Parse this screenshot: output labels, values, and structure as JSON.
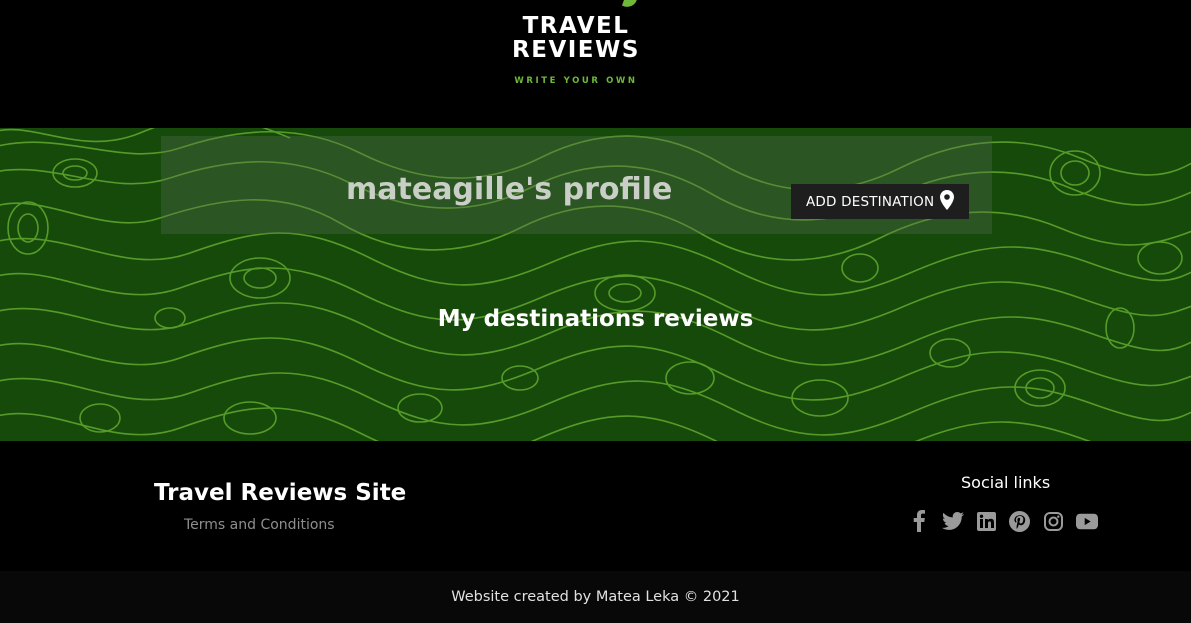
{
  "header": {
    "logo_line1": "TRAVEL",
    "logo_line2": "REVIEWS",
    "logo_tagline": "WRITE YOUR OWN"
  },
  "profile": {
    "title": "mateagille's profile",
    "add_button_label": "ADD DESTINATION",
    "add_button_icon": "map-pin-icon"
  },
  "main": {
    "section_title": "My destinations reviews"
  },
  "footer": {
    "site_name": "Travel Reviews Site",
    "terms_link": "Terms and Conditions",
    "social_title": "Social links",
    "social_icons": [
      "facebook-icon",
      "twitter-icon",
      "linkedin-icon",
      "pinterest-icon",
      "instagram-icon",
      "youtube-icon"
    ],
    "copyright": "Website created by Matea Leka © 2021"
  },
  "colors": {
    "accent_green": "#6fb83a",
    "pattern_bg": "#164a0b",
    "pattern_lines": "#5aa02a",
    "button_bg": "#1e1e1e",
    "social_icon": "#9a9a9a"
  }
}
